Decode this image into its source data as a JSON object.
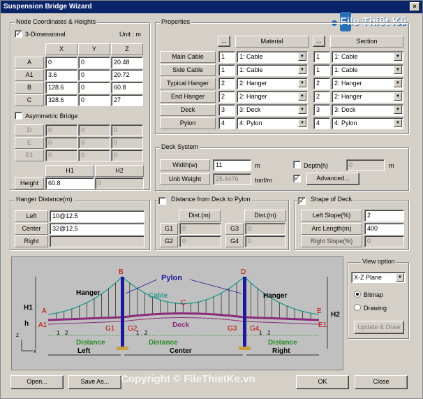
{
  "window": {
    "title": "Suspension Bridge Wizard",
    "close_glyph": "×"
  },
  "watermark": {
    "brand": "File Thiết Kế",
    "domain": ".vn",
    "footer": "Copyright © FileThietKe.vn"
  },
  "node": {
    "group_title": "Node Coordinates & Heights",
    "three_d_label": "3-Dimensional",
    "three_d_checked": true,
    "unit": "Unit : m",
    "headers": [
      "X",
      "Y",
      "Z"
    ],
    "rows": [
      {
        "name": "A",
        "x": "0",
        "y": "0",
        "z": "20.48"
      },
      {
        "name": "A1",
        "x": "3.6",
        "y": "0",
        "z": "20.72"
      },
      {
        "name": "B",
        "x": "128.6",
        "y": "0",
        "z": "60.8"
      },
      {
        "name": "C",
        "x": "328.6",
        "y": "0",
        "z": "27"
      }
    ],
    "asym_label": "Asymmetric Bridge",
    "asym_checked": false,
    "asym_rows": [
      {
        "name": "D",
        "x": "0",
        "y": "0",
        "z": "0"
      },
      {
        "name": "E",
        "x": "0",
        "y": "0",
        "z": "0"
      },
      {
        "name": "E1",
        "x": "0",
        "y": "0",
        "z": "0"
      }
    ],
    "h1": "H1",
    "h2": "H2",
    "height_label": "Height",
    "height_h1": "60.8",
    "height_h2": "0"
  },
  "properties": {
    "group_title": "Properties",
    "dots": "...",
    "material_header": "Material",
    "section_header": "Section",
    "rows": [
      {
        "label": "Main Cable",
        "mnum": "1",
        "mat": "1: Cable",
        "snum": "1",
        "sec": "1: Cable"
      },
      {
        "label": "Side Cable",
        "mnum": "1",
        "mat": "1: Cable",
        "snum": "1",
        "sec": "1: Cable"
      },
      {
        "label": "Typical Hanger",
        "mnum": "2",
        "mat": "2: Hanger",
        "snum": "2",
        "sec": "2: Hanger"
      },
      {
        "label": "End Hanger",
        "mnum": "2",
        "mat": "2: Hanger",
        "snum": "2",
        "sec": "2: Hanger"
      },
      {
        "label": "Deck",
        "mnum": "3",
        "mat": "3: Deck",
        "snum": "3",
        "sec": "3: Deck"
      },
      {
        "label": "Pylon",
        "mnum": "4",
        "mat": "4: Pylon",
        "snum": "4",
        "sec": "4: Pylon"
      }
    ]
  },
  "deck": {
    "group_title": "Deck System",
    "width_label": "Width(w)",
    "width": "11",
    "width_unit": "m",
    "depth_label": "Depth(h)",
    "depth": "0",
    "depth_unit": "m",
    "weight_label": "Unit Weight",
    "weight": "25.4476",
    "weight_unit": "tonf/m",
    "advanced": "Advanced..."
  },
  "hanger": {
    "group_title": "Hanger Distance(m)",
    "left_label": "Left",
    "left": "10@12.5",
    "center_label": "Center",
    "center": "32@12.5",
    "right_label": "Right",
    "right": ""
  },
  "dist": {
    "group_title": "Distance from Deck to Pylon",
    "header": "Dist.(m)",
    "g1": "G1",
    "g2": "G2",
    "g3": "G3",
    "g4": "G4",
    "v1": "0",
    "v2": "0",
    "v3": "0",
    "v4": "0"
  },
  "shape": {
    "group_title": "Shape of Deck",
    "left_label": "Left Slope(%)",
    "left": "2",
    "arc_label": "Arc Length(m)",
    "arc": "400",
    "right_label": "Right Slope(%)",
    "right": "0"
  },
  "view": {
    "group_title": "View option",
    "plane": "X-Z Plane",
    "bitmap": "Bitmap",
    "drawing": "Drawing",
    "update": "Update & Draw"
  },
  "diagram": {
    "pylon": "Pylon",
    "cable": "Cable",
    "hanger_l": "Hanger",
    "hanger_r": "Hanger",
    "deck": "Deck",
    "A": "A",
    "A1": "A1",
    "B": "B",
    "C": "C",
    "D": "D",
    "E": "E",
    "E1": "E1",
    "G1": "G1",
    "G2": "G2",
    "G3": "G3",
    "G4": "G4",
    "H1": "H1",
    "H2": "H2",
    "h": "h",
    "dist1": "Distance",
    "dist2": "Distance",
    "dist3": "Distance",
    "left": "Left",
    "center": "Center",
    "right": "Right",
    "z": "z",
    "x": "x",
    "n1": "1",
    "n2": "2"
  },
  "footer": {
    "open": "Open...",
    "save_as": "Save As...",
    "ok": "OK",
    "close": "Close"
  }
}
